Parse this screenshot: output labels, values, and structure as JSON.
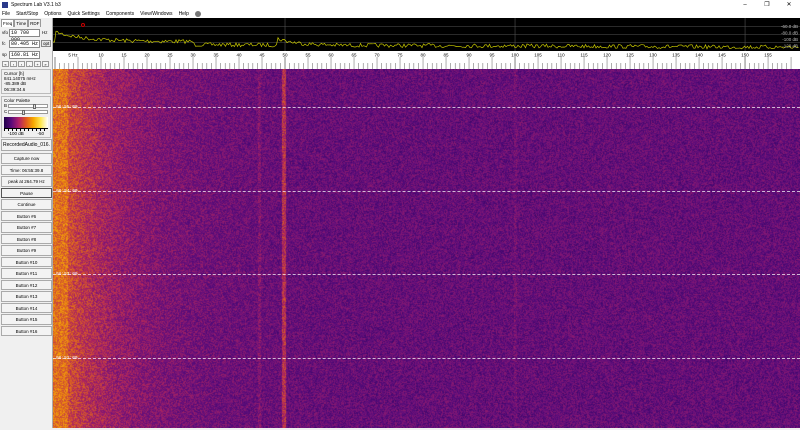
{
  "window": {
    "title": "Spectrum Lab V3.1 b3",
    "minimize": "–",
    "restore": "❐",
    "close": "✕"
  },
  "menu": [
    "File",
    "Start/Stop",
    "Options",
    "Quick Settings",
    "Components",
    "View/Windows",
    "Help"
  ],
  "left": {
    "tabs": [
      "Freq",
      "Time",
      "RDF"
    ],
    "vfo": {
      "label": "vfo",
      "value": "10 700 000",
      "unit": "Hz"
    },
    "fc": {
      "label": "fc",
      "value": "80.405 Hz",
      "opt": "opt"
    },
    "sp": {
      "label": "sp",
      "value": "160.81 Hz"
    },
    "arrows": [
      "«",
      "‹",
      "›",
      "-",
      "+",
      "»"
    ],
    "cursor": {
      "title": "Cursor [h]",
      "freq": "841.14075 mHz",
      "level": "-85.389 dB",
      "time": "06:39:34.6"
    },
    "palette": {
      "title": "Color Palette",
      "b": "B",
      "c": "C",
      "b_level": 0.62,
      "c_level": 0.35,
      "min": "-100 dB",
      "max": "-50"
    },
    "buttons": [
      "RecordedAudio_016.",
      "Capture now",
      "Time:  06:55:39.8",
      "peak at 264.79 Hz",
      "Pause",
      "Continue",
      "Button #6",
      "Button #7",
      "Button #8",
      "Button #9",
      "Button #10",
      "Button #11",
      "Button #12",
      "Button #13",
      "Button #14",
      "Button #15",
      "Button #16"
    ]
  },
  "spectrum": {
    "db_labels": [
      "-60.0 dB",
      "-80.0 dB",
      "-100 dB",
      "-120 dB"
    ],
    "trace_color": "#c8c800"
  },
  "freq_scale": {
    "labels": [
      "5 Hz",
      "10",
      "15",
      "20",
      "25",
      "30",
      "35",
      "40",
      "45",
      "50",
      "55",
      "60",
      "65",
      "70",
      "75",
      "80",
      "85",
      "90",
      "95",
      "100",
      "105",
      "110",
      "115",
      "120",
      "125",
      "130",
      "135",
      "140",
      "145",
      "150",
      "155"
    ],
    "range_hz": [
      0,
      160
    ]
  },
  "waterfall": {
    "time_labels": [
      "06:55:00",
      "06:54:00",
      "06:53:00",
      "06:52:00"
    ]
  }
}
